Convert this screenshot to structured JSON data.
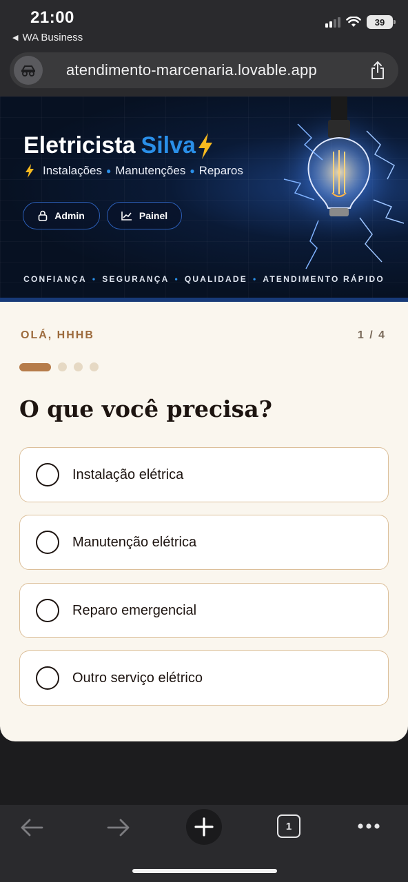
{
  "status_bar": {
    "time": "21:00",
    "back_app": "WA Business",
    "battery": "39"
  },
  "browser": {
    "url": "atendimento-marcenaria.lovable.app",
    "tab_count": "1"
  },
  "hero": {
    "title_main": "Eletricista",
    "title_accent": "Silva",
    "services": [
      "Instalações",
      "Manutenções",
      "Reparos"
    ],
    "admin_label": "Admin",
    "painel_label": "Painel",
    "tagline": [
      "CONFIANÇA",
      "SEGURANÇA",
      "QUALIDADE",
      "ATENDIMENTO RÁPIDO"
    ],
    "accent_color": "#2a8fe8"
  },
  "form": {
    "greeting": "OLÁ, HHHB",
    "step": "1 / 4",
    "progress": {
      "current": 1,
      "total": 4
    },
    "question": "O que você precisa?",
    "options": [
      "Instalação elétrica",
      "Manutenção elétrica",
      "Reparo emergencial",
      "Outro serviço elétrico"
    ]
  },
  "icons": [
    "back-arrow-icon",
    "forward-arrow-icon",
    "plus-icon",
    "tabs-icon",
    "more-icon",
    "share-icon",
    "lock-icon",
    "chart-icon",
    "bolt-icon"
  ]
}
